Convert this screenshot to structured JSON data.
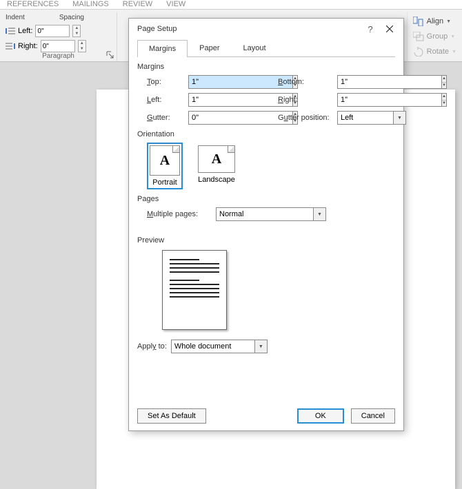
{
  "ribbon_tabs": {
    "t1": "REFERENCES",
    "t2": "MAILINGS",
    "t3": "REVIEW",
    "t4": "VIEW"
  },
  "ribbon": {
    "indent_h": "Indent",
    "spacing_h": "Spacing",
    "left_label": "Left:",
    "right_label": "Right:",
    "left_val": "0\"",
    "right_val": "0\"",
    "paragraph_group": "Paragraph",
    "align": "Align",
    "group": "Group",
    "rotate": "Rotate"
  },
  "dialog": {
    "title": "Page Setup",
    "tabs": {
      "margins": "Margins",
      "paper": "Paper",
      "layout": "Layout"
    },
    "margins_section": "Margins",
    "top": "Top:",
    "bottom": "Bottom:",
    "left": "Left:",
    "right": "Right:",
    "gutter": "Gutter:",
    "gutter_pos": "Gutter position:",
    "vals": {
      "top": "1\"",
      "bottom": "1\"",
      "left": "1\"",
      "right": "1\"",
      "gutter": "0\"",
      "gutter_pos": "Left"
    },
    "orientation_section": "Orientation",
    "portrait": "Portrait",
    "landscape": "Landscape",
    "pages_section": "Pages",
    "multiple_pages": "Multiple pages:",
    "multiple_pages_val": "Normal",
    "preview_section": "Preview",
    "apply_to": "Apply to:",
    "apply_to_val": "Whole document",
    "set_default": "Set As Default",
    "ok": "OK",
    "cancel": "Cancel"
  }
}
